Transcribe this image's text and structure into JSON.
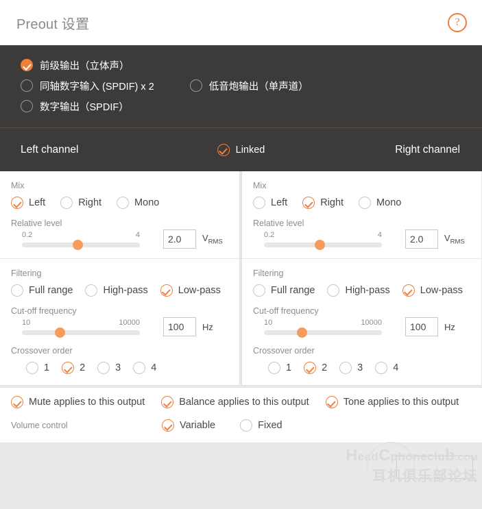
{
  "header": {
    "title": "Preout 设置",
    "help_label": "?"
  },
  "output_select": {
    "rows": [
      [
        {
          "label": "前级输出（立体声）",
          "checked": true,
          "name": "preamp-stereo"
        }
      ],
      [
        {
          "label": "同轴数字输入 (SPDIF) x 2",
          "checked": false,
          "name": "coax-spdif-x2"
        },
        {
          "label": "低音炮输出（单声道）",
          "checked": false,
          "name": "subwoofer-mono"
        }
      ],
      [
        {
          "label": "数字输出（SPDIF）",
          "checked": false,
          "name": "digital-out-spdif"
        }
      ]
    ]
  },
  "linked_bar": {
    "left_channel": "Left channel",
    "right_channel": "Right channel",
    "linked_label": "Linked",
    "linked_checked": true
  },
  "channels": [
    {
      "side": "left",
      "mix": {
        "label": "Mix",
        "options": [
          {
            "label": "Left",
            "checked": true
          },
          {
            "label": "Right",
            "checked": false
          },
          {
            "label": "Mono",
            "checked": false
          }
        ]
      },
      "relative_level": {
        "label": "Relative level",
        "min_tick": "0.2",
        "max_tick": "4",
        "value": "2.0",
        "unit_main": "V",
        "unit_sub": "RMS",
        "thumb_pct": 47
      },
      "filtering": {
        "label": "Filtering",
        "options": [
          {
            "label": "Full range",
            "checked": false
          },
          {
            "label": "High-pass",
            "checked": false
          },
          {
            "label": "Low-pass",
            "checked": true
          }
        ]
      },
      "cutoff": {
        "label": "Cut-off frequency",
        "min_tick": "10",
        "max_tick": "10000",
        "value": "100",
        "unit_main": "Hz",
        "thumb_pct": 32
      },
      "crossover": {
        "label": "Crossover order",
        "options": [
          {
            "label": "1",
            "checked": false
          },
          {
            "label": "2",
            "checked": true
          },
          {
            "label": "3",
            "checked": false
          },
          {
            "label": "4",
            "checked": false
          }
        ]
      }
    },
    {
      "side": "right",
      "mix": {
        "label": "Mix",
        "options": [
          {
            "label": "Left",
            "checked": false
          },
          {
            "label": "Right",
            "checked": true
          },
          {
            "label": "Mono",
            "checked": false
          }
        ]
      },
      "relative_level": {
        "label": "Relative level",
        "min_tick": "0.2",
        "max_tick": "4",
        "value": "2.0",
        "unit_main": "V",
        "unit_sub": "RMS",
        "thumb_pct": 47
      },
      "filtering": {
        "label": "Filtering",
        "options": [
          {
            "label": "Full range",
            "checked": false
          },
          {
            "label": "High-pass",
            "checked": false
          },
          {
            "label": "Low-pass",
            "checked": true
          }
        ]
      },
      "cutoff": {
        "label": "Cut-off frequency",
        "min_tick": "10",
        "max_tick": "10000",
        "value": "100",
        "unit_main": "Hz",
        "thumb_pct": 32
      },
      "crossover": {
        "label": "Crossover order",
        "options": [
          {
            "label": "1",
            "checked": false
          },
          {
            "label": "2",
            "checked": true
          },
          {
            "label": "3",
            "checked": false
          },
          {
            "label": "4",
            "checked": false
          }
        ]
      }
    }
  ],
  "applies": [
    {
      "label": "Mute applies to this output",
      "checked": true,
      "name": "mute-applies"
    },
    {
      "label": "Balance applies to this output",
      "checked": true,
      "name": "balance-applies"
    },
    {
      "label": "Tone applies to this output",
      "checked": true,
      "name": "tone-applies"
    }
  ],
  "volume_control": {
    "label": "Volume control",
    "options": [
      {
        "label": "Variable",
        "checked": true
      },
      {
        "label": "Fixed",
        "checked": false
      }
    ]
  },
  "footer": {
    "button_label": "",
    "watermark_en_cap": "H",
    "watermark_en_1": "ead",
    "watermark_en_cap2": "C",
    "watermark_en_2": "phoneclu",
    "watermark_en_cap3": "b",
    "watermark_domain": ".COM",
    "watermark_cn": "耳机俱乐部论坛"
  },
  "colors": {
    "accent": "#f07f3c",
    "dark_panel": "#3d3b39",
    "page_bg": "#e9e9e9",
    "text_muted": "#8e8c8a"
  }
}
